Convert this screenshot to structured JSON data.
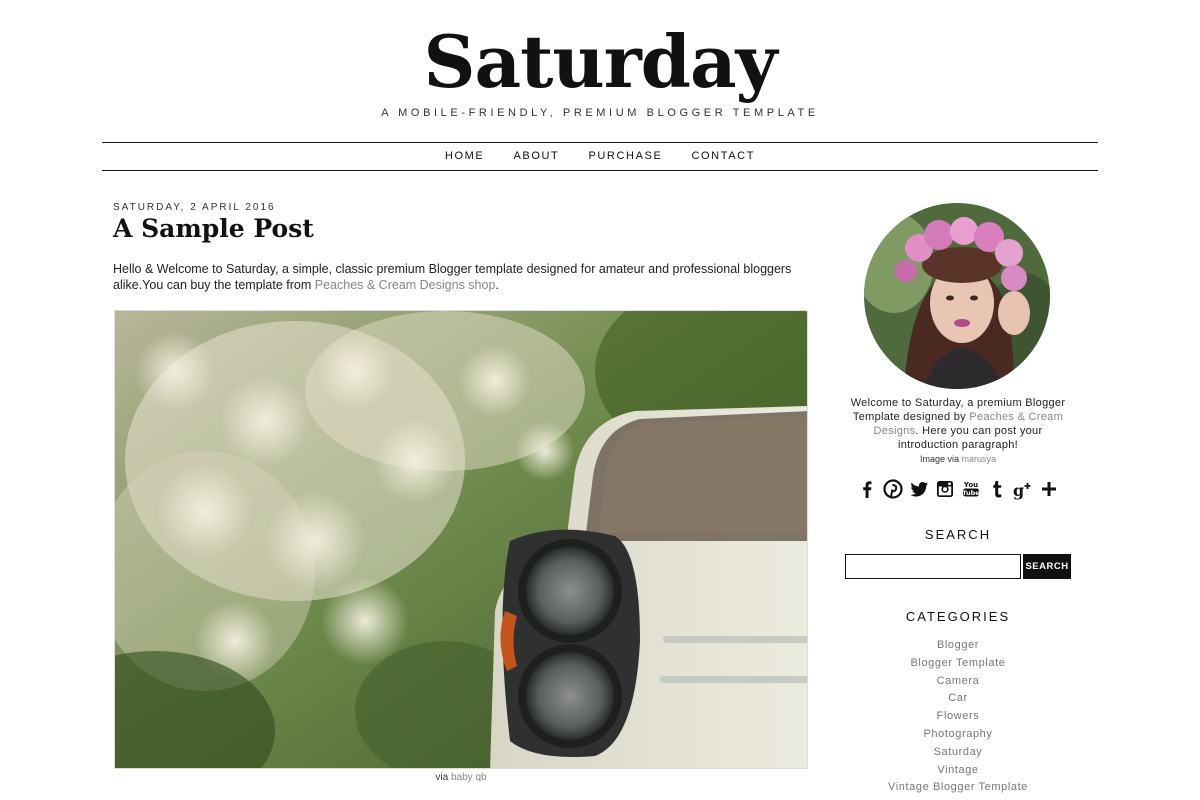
{
  "header": {
    "title": "Saturday",
    "description": "A MOBILE-FRIENDLY, PREMIUM BLOGGER TEMPLATE"
  },
  "nav": {
    "items": [
      {
        "label": "HOME"
      },
      {
        "label": "ABOUT"
      },
      {
        "label": "PURCHASE"
      },
      {
        "label": "CONTACT"
      }
    ]
  },
  "post": {
    "date": "SATURDAY, 2 APRIL 2016",
    "title": "A Sample Post",
    "intro": "Hello & Welcome to Saturday, a simple, classic premium Blogger template designed for amateur and professional bloggers alike.You can buy the template from ",
    "link_text": "Peaches & Cream Designs shop",
    "after_link": ".",
    "caption_prefix": "via ",
    "caption_link": "baby qb"
  },
  "sidebar": {
    "about_text_1": "Welcome to Saturday, a premium Blogger Template designed by ",
    "about_link": "Peaches & Cream Designs",
    "about_text_2": ". Here you can post your introduction paragraph!",
    "image_credit_prefix": "Image via ",
    "image_credit_link": "marusya",
    "social_icons": [
      "facebook-icon",
      "pinterest-icon",
      "twitter-icon",
      "instagram-icon",
      "youtube-icon",
      "tumblr-icon",
      "google-plus-icon",
      "plus-icon"
    ],
    "search_title": "SEARCH",
    "search_button": "SEARCH",
    "search_value": "",
    "categories_title": "CATEGORIES",
    "categories": [
      "Blogger",
      "Blogger Template",
      "Camera",
      "Car",
      "Flowers",
      "Photography",
      "Saturday",
      "Vintage",
      "Vintage Blogger Template"
    ]
  }
}
